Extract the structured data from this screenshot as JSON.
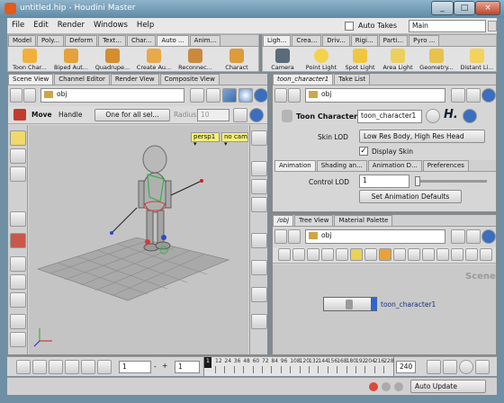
{
  "window": {
    "title": "untitled.hip - Houdini Master",
    "minimize": "_",
    "maximize": "□",
    "close": "×"
  },
  "menu": [
    "File",
    "Edit",
    "Render",
    "Windows",
    "Help"
  ],
  "auto_takes": "Auto Takes",
  "main_select": "Main",
  "shelf_left": {
    "tabs": [
      "Model",
      "Poly...",
      "Deform",
      "Text...",
      "Char...",
      "Auto ...",
      "Anim..."
    ],
    "tools": [
      {
        "label": "Toon Char...",
        "icon": "toon-character-icon"
      },
      {
        "label": "Biped Aut...",
        "icon": "biped-icon"
      },
      {
        "label": "Quadrupe...",
        "icon": "quadruped-icon"
      },
      {
        "label": "Create Au...",
        "icon": "create-autorig-icon"
      },
      {
        "label": "Reconnec...",
        "icon": "reconnect-icon"
      },
      {
        "label": "Charact",
        "icon": "character-icon"
      }
    ]
  },
  "shelf_right": {
    "tabs": [
      "Ligh...",
      "Crea...",
      "Driv...",
      "Rigi...",
      "Parti...",
      "Pyro ..."
    ],
    "tools": [
      {
        "label": "Camera",
        "icon": "camera-icon"
      },
      {
        "label": "Point Light",
        "icon": "point-light-icon"
      },
      {
        "label": "Spot Light",
        "icon": "spot-light-icon"
      },
      {
        "label": "Area Light",
        "icon": "area-light-icon"
      },
      {
        "label": "Geometry...",
        "icon": "geometry-light-icon"
      },
      {
        "label": "Distant Li...",
        "icon": "distant-light-icon"
      }
    ]
  },
  "left_panel": {
    "tabs": [
      "Scene View",
      "Channel Editor",
      "Render View",
      "Composite View"
    ],
    "path": "obj",
    "move_label": "Move",
    "handle_label": "Handle",
    "handle_select": "One for all sel...",
    "radius_label": "Radius",
    "radius_value": "10",
    "camera_menu": "persp1 ▾",
    "cam_menu": "no cam ▾"
  },
  "params": {
    "tabs": [
      "toon_character1",
      "Take List"
    ],
    "path": "obj",
    "node_type": "Toon Character",
    "node_name": "toon_character1",
    "skin_lod_label": "Skin LOD",
    "skin_lod_value": "Low Res Body, High Res Head",
    "display_skin": "Display Skin",
    "display_skin_checked": true,
    "subtabs": [
      "Animation",
      "Shading an...",
      "Animation D...",
      "Preferences"
    ],
    "control_lod_label": "Control LOD",
    "control_lod_value": "1",
    "control_lod_fraction": 0.05,
    "anim_defaults_button": "Set Animation Defaults"
  },
  "network": {
    "tabs": [
      "/obj",
      "Tree View",
      "Material Palette"
    ],
    "path": "obj",
    "context_label": "Scene",
    "node_label": "toon_character1"
  },
  "timeline": {
    "frame": "1",
    "start": "1",
    "end": "240",
    "step": "-",
    "plus": "+",
    "ticks": [
      "12",
      "24",
      "36",
      "48",
      "60",
      "72",
      "84",
      "96",
      "108",
      "120",
      "132",
      "144",
      "156",
      "168",
      "180",
      "192",
      "204",
      "216",
      "228"
    ],
    "current_marker": "1"
  },
  "status": {
    "auto_update": "Auto Update"
  }
}
